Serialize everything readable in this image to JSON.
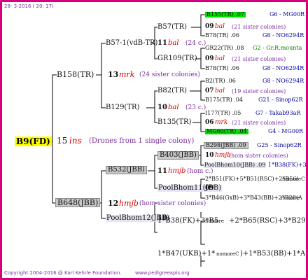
{
  "header": {
    "date": "28- 3-2016 ( 20: 17)"
  },
  "footer": {
    "copyright": "Copyright 2004-2016 @ Karl Kehrle Foundation.",
    "site": "www.pedigreeapis.org"
  },
  "root": {
    "name": "B9(FD)",
    "gen": "15",
    "type": "ins",
    "note": "(Drones from 1 single colony)"
  },
  "sire": {
    "name": "B158(TR)",
    "gen": "13",
    "type": "mrk",
    "note": "(24 sister colonies)",
    "s": {
      "name": "B57-1(vdB-TR)",
      "gen": "11",
      "type": "bal",
      "note": "(24 c.)",
      "s": {
        "name": "B57(TR)",
        "gen": "09",
        "type": "bal",
        "note": "(21 sister colonies)",
        "s": {
          "name": "B155(TR) .07",
          "origin": "G6 - MG00R"
        },
        "d": {
          "name": "B78(TR) .06",
          "origin": "G8 - NO6294R"
        }
      },
      "d": {
        "name": "GR109(TR)",
        "gen": "09",
        "type": "bal",
        "note": "(21 sister colonies)",
        "s": {
          "name": "GR22(TR) .08",
          "origin": "G2 - Gr.R.mounta"
        },
        "d": {
          "name": "B78(TR) .06",
          "origin": "G8 - NO6294R"
        }
      }
    },
    "d": {
      "name": "B129(TR)",
      "gen": "10",
      "type": "bal",
      "note": "(23 c.)",
      "s": {
        "name": "B82(TR)",
        "gen": "07",
        "type": "bal",
        "note": "(19 sister colonies)",
        "s": {
          "name": "B2(TR) .06",
          "origin": "G8 - NO6294R"
        },
        "d": {
          "name": "B175(TR) .04",
          "origin": "G21 - Sinop62R"
        }
      },
      "d": {
        "name": "B135(TR)",
        "gen": "06",
        "type": "mrk",
        "note": "(21 sister colonies)",
        "s": {
          "name": "I177(TR) .05",
          "origin": "G7 - Takab93aR"
        },
        "d": {
          "name": "MG60(TR) .04",
          "origin": "G4 - MG00R"
        }
      }
    }
  },
  "dam": {
    "name": "B648(JBB)",
    "gen": "12",
    "type": "hmjb",
    "note": "(hom sister colonies)",
    "s": {
      "name": "B532(JBB)",
      "gen": "11",
      "type": "hmjb",
      "note": "(hom c.)",
      "s": {
        "name": "B403(JBB)",
        "gen": "10",
        "type": "hmjb",
        "note": "(hom sister colonies)",
        "s": {
          "name": "B298(JBB) .09",
          "origin": "G25 - Sinop62R"
        },
        "d": {
          "name": "PoolBhom10(JBB) .09",
          "origin": "1*B38(FK)+3"
        }
      },
      "d": {
        "name": "PoolBhom11(JBB)",
        "gen": "10",
        "prefix": "09",
        "s": {
          "text": "2*B51(FK)+5*B51(RSC)+2*B56(",
          "mod": "nomoreC"
        },
        "d": {
          "text": "3*B46(GxB)+3*B43(BB)+2*B28(A",
          "mod": "nomore"
        }
      }
    },
    "d": {
      "name": "PoolBhom12(JBB)",
      "gen": "10",
      "s": {
        "text": "1*B38(FK)+3*B5",
        "mod": "nomore",
        "text2": "+2*B65(RSC)+3*B29"
      },
      "d": {
        "text": "1*B47(UKB)+1*",
        "mod": "nomoreC",
        "text2": ")+1*B53(BB)+1*A"
      }
    }
  }
}
